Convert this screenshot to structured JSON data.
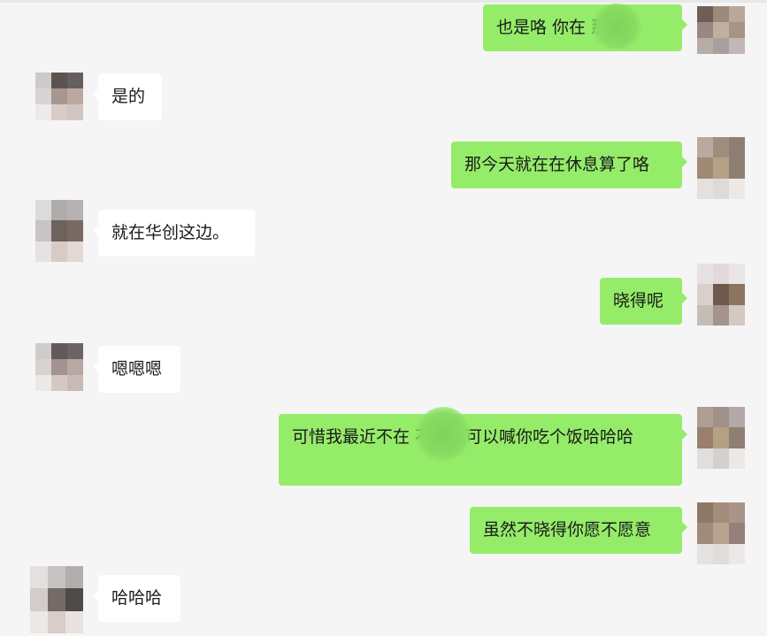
{
  "chat": {
    "messages": [
      {
        "side": "out",
        "text": "也是咯 你在 那边",
        "redacted": true
      },
      {
        "side": "in",
        "text": "是的"
      },
      {
        "side": "out",
        "text": "那今天就在在休息算了咯"
      },
      {
        "side": "in",
        "text": "就在华创这边。"
      },
      {
        "side": "out",
        "text": "晓得呢"
      },
      {
        "side": "in",
        "text": "嗯嗯嗯"
      },
      {
        "side": "out",
        "text": "可惜我最近不在 不然想可以喊你吃个饭哈哈哈",
        "redacted": true
      },
      {
        "side": "out",
        "text": "虽然不晓得你愿不愿意"
      },
      {
        "side": "in",
        "text": "哈哈哈"
      }
    ]
  },
  "colors": {
    "background": "#f5f5f5",
    "outgoing_bubble": "#95ec69",
    "incoming_bubble": "#ffffff",
    "text": "#1a1a1a"
  }
}
